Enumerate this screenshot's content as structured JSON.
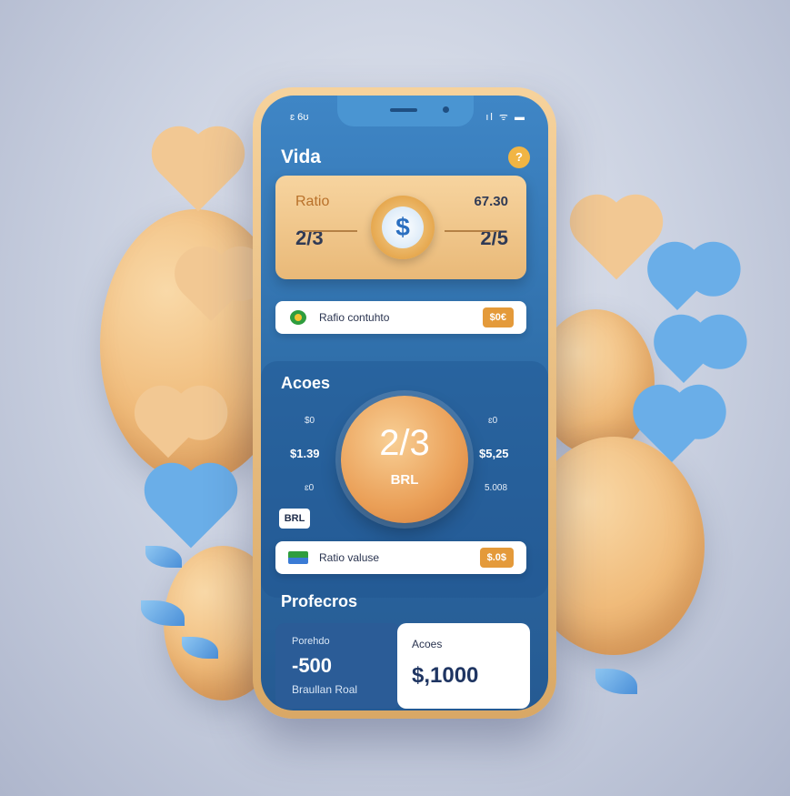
{
  "status": {
    "time": "ɛ 6ʊ",
    "icons": "ıl ᯤ ▬"
  },
  "app": {
    "title": "Vida",
    "help_icon": "?"
  },
  "ratio_card": {
    "label": "Ratio",
    "left_value": "2/3",
    "right_label": "67.30",
    "right_value": "2/5",
    "coin_symbol": "$"
  },
  "pill_1": {
    "text": "Rafio contuhto",
    "badge": "$0€"
  },
  "acoes": {
    "title": "Acoes",
    "left_top": "$0",
    "left_value": "$1.39",
    "left_bottom": "ɛ0",
    "right_top": "ɛ0",
    "right_value": "$5,25",
    "right_bottom": "5.008",
    "big_ratio": "2/3",
    "big_unit": "BRL",
    "chip": "BRL"
  },
  "pill_2": {
    "text": "Ratio valuse",
    "badge": "$.0$"
  },
  "profecros": {
    "title": "Profecros",
    "left_label": "Porehdo",
    "left_value": "-500",
    "left_sub": "Braullan Roal",
    "right_label": "Acoes",
    "right_value": "$,1000"
  },
  "colors": {
    "accent": "#e49a3a",
    "screen_blue": "#2f6ea9",
    "card_peach": "#f7d49f"
  }
}
